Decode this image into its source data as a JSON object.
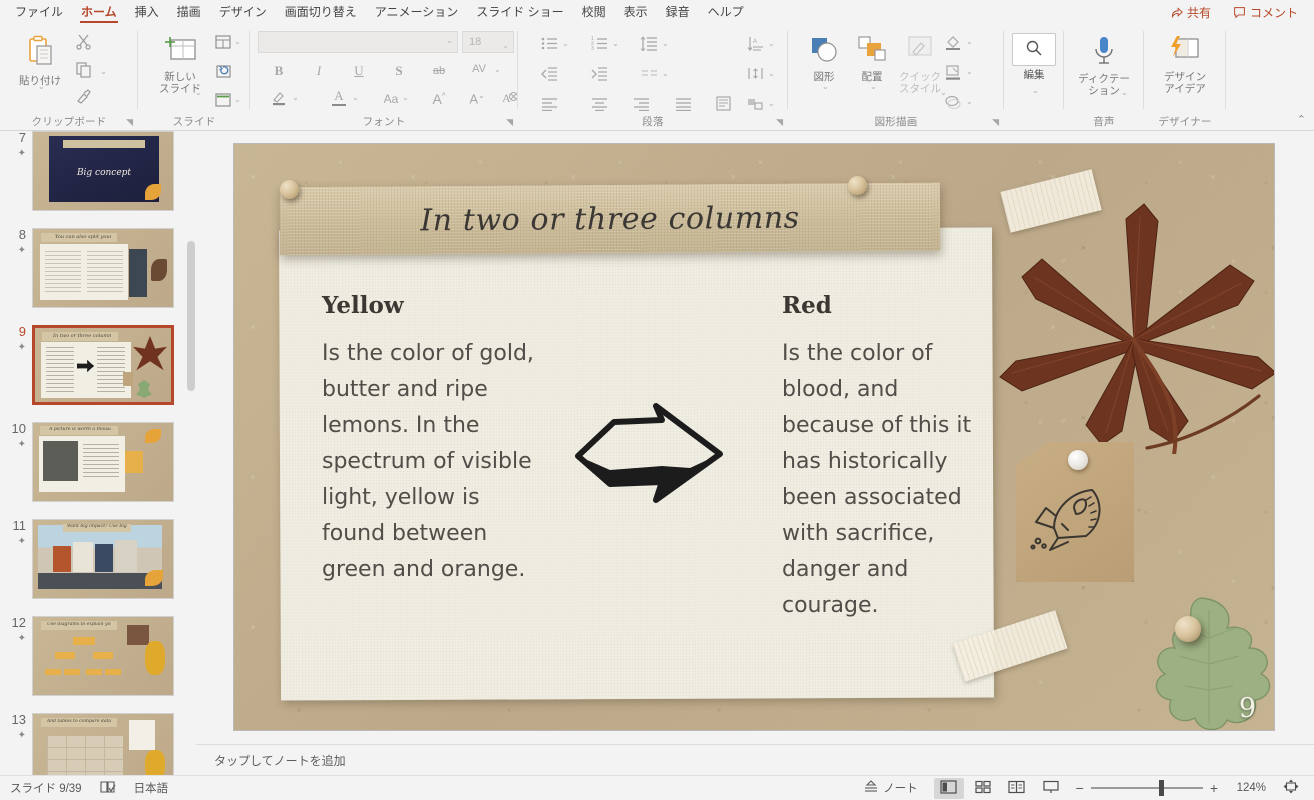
{
  "app": {
    "menu_tabs": [
      {
        "label": "ファイル",
        "active": false
      },
      {
        "label": "ホーム",
        "active": true
      },
      {
        "label": "挿入",
        "active": false
      },
      {
        "label": "描画",
        "active": false
      },
      {
        "label": "デザイン",
        "active": false
      },
      {
        "label": "画面切り替え",
        "active": false
      },
      {
        "label": "アニメーション",
        "active": false
      },
      {
        "label": "スライド ショー",
        "active": false
      },
      {
        "label": "校閲",
        "active": false
      },
      {
        "label": "表示",
        "active": false
      },
      {
        "label": "録音",
        "active": false
      },
      {
        "label": "ヘルプ",
        "active": false
      }
    ],
    "share_label": "共有",
    "comment_label": "コメント",
    "accent_color": "#b7472a"
  },
  "ribbon": {
    "collapse_icon": "chevron-up-icon",
    "groups": [
      {
        "name": "clipboard",
        "label": "クリップボード",
        "paste_label": "貼り付け",
        "buttons": [
          "cut-icon",
          "copy-icon",
          "format-painter-icon"
        ]
      },
      {
        "name": "slides",
        "label": "スライド",
        "new_slide_label": "新しい\nスライド",
        "buttons": [
          "layout-icon",
          "reset-icon",
          "section-icon"
        ]
      },
      {
        "name": "font",
        "label": "フォント",
        "font_name_value": "",
        "font_name_placeholder": "",
        "font_size_value": "18",
        "bold": "B",
        "italic": "I",
        "underline": "U",
        "shadow": "S",
        "strikethrough": "ab",
        "char_spacing": "AV",
        "text_highlight": "highlight-icon",
        "font_color": "A",
        "change_case": "Aa",
        "grow_font": "A",
        "shrink_font": "A",
        "clear_format": "clear-formatting-icon"
      },
      {
        "name": "paragraph",
        "label": "段落",
        "buttons": [
          "bullets-icon",
          "numbering-icon",
          "line-spacing-icon",
          "decrease-indent-icon",
          "increase-indent-icon",
          "columns-icon",
          "align-left-icon",
          "align-center-icon",
          "align-right-icon",
          "justify-icon",
          "text-direction-icon",
          "align-text-icon",
          "text-direction-vertical-icon",
          "convert-smartart-icon"
        ]
      },
      {
        "name": "drawing",
        "label": "図形描画",
        "shapes_label": "図形",
        "arrange_label": "配置",
        "quick_styles_label": "クイック\nスタイル",
        "shape_fill": "shape-fill-icon",
        "shape_outline": "shape-outline-icon",
        "shape_effects": "shape-effects-icon"
      },
      {
        "name": "editing",
        "label": "",
        "edit_label": "編集",
        "icon": "search-icon"
      },
      {
        "name": "voice",
        "label": "音声",
        "dictate_label": "ディクテー\nション",
        "icon": "microphone-icon"
      },
      {
        "name": "designer",
        "label": "デザイナー",
        "design_ideas_label": "デザイン\nアイデア",
        "icon": "design-ideas-icon"
      }
    ]
  },
  "thumbnails": {
    "selected_index": 9,
    "items": [
      {
        "number": "7",
        "title": "Big concept",
        "has_star": true
      },
      {
        "number": "8",
        "title": "You can also split your content",
        "has_star": true
      },
      {
        "number": "9",
        "title": "In two or three columns",
        "has_star": true
      },
      {
        "number": "10",
        "title": "A picture is worth a thousand words",
        "has_star": true
      },
      {
        "number": "11",
        "title": "Want big impact? Use big image",
        "has_star": true
      },
      {
        "number": "12",
        "title": "Use diagrams to explain your idea",
        "has_star": true
      },
      {
        "number": "13",
        "title": "And tables to compare data",
        "has_star": true
      }
    ]
  },
  "slide": {
    "title": "In two or three columns",
    "number": "9",
    "columns": [
      {
        "heading": "Yellow",
        "body": "Is the color of gold, butter and ripe lemons. In the spectrum of visible light, yellow is found between green and orange."
      },
      {
        "heading": "Red",
        "body": "Is the color of blood, and because of this it has historically been associated with sacrifice, danger and courage."
      }
    ],
    "decorations": [
      "maple-leaf-image",
      "oak-leaf-image",
      "kraft-tag-image",
      "rocket-doodle-icon",
      "arrow-doodle-icon",
      "washi-tape-image",
      "pushpin-image"
    ]
  },
  "notes": {
    "placeholder": "タップしてノートを追加"
  },
  "status": {
    "slide_counter": "スライド 9/39",
    "proofing_icon": "spellcheck-icon",
    "language": "日本語",
    "notes_label": "ノート",
    "views": [
      {
        "name": "normal-view",
        "icon": "normal-view-icon",
        "active": true
      },
      {
        "name": "slide-sorter-view",
        "icon": "slide-sorter-icon",
        "active": false
      },
      {
        "name": "reading-view",
        "icon": "reading-view-icon",
        "active": false
      },
      {
        "name": "slideshow-view",
        "icon": "slideshow-icon",
        "active": false
      }
    ],
    "zoom_out": "−",
    "zoom_in": "+",
    "zoom_level": "124%",
    "fit_window_icon": "fit-to-window-icon"
  }
}
